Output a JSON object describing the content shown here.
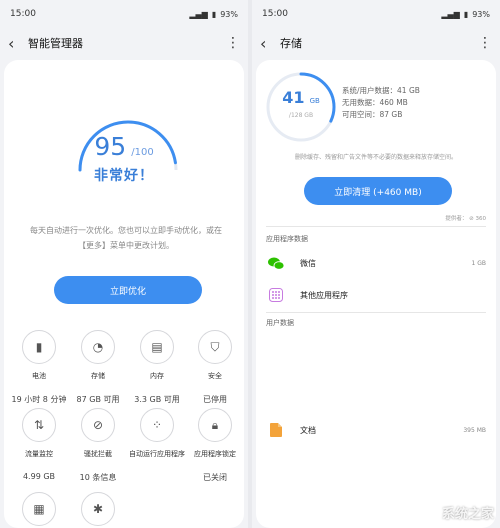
{
  "left": {
    "status": {
      "time": "15:00",
      "battery": "93%"
    },
    "title": "智能管理器",
    "score": "95",
    "score_max": "/100",
    "verdict": "非常好！",
    "score_fraction": 0.95,
    "description": "每天自动进行一次优化。您也可以立即手动优化，或在【更多】菜单中更改计划。",
    "optimize_button": "立即优化",
    "tiles": [
      {
        "icon": "battery-icon",
        "label": "电池",
        "value": "19 小时 8 分钟"
      },
      {
        "icon": "storage-icon",
        "label": "存储",
        "value": "87 GB 可用"
      },
      {
        "icon": "memory-icon",
        "label": "内存",
        "value": "3.3 GB 可用"
      },
      {
        "icon": "shield-icon",
        "label": "安全",
        "value": "已停用"
      },
      {
        "icon": "data-monitor-icon",
        "label": "流量监控",
        "value": "4.99 GB"
      },
      {
        "icon": "block-icon",
        "label": "骚扰拦截",
        "value": "10 条信息"
      },
      {
        "icon": "autostart-icon",
        "label": "自动运行应用程序",
        "value": ""
      },
      {
        "icon": "lock-icon",
        "label": "应用程序锁定",
        "value": "已关闭"
      }
    ]
  },
  "right": {
    "status": {
      "time": "15:00",
      "battery": "93%"
    },
    "title": "存储",
    "used": "41",
    "used_unit": "GB",
    "total": "/128 GB",
    "used_fraction": 0.32,
    "stats": [
      "系统/用户数据：41 GB",
      "无用数据：460 MB",
      "可用空间：87 GB"
    ],
    "hint": "删除缓存、残留和广告文件等不必要的数据来释放存储空间。",
    "clean_button": "立即清理 (+460 MB)",
    "powered_by": "提供者：  ⊘ 360",
    "app_data_label": "应用程序数据",
    "apps": [
      {
        "icon": "wechat-icon",
        "name": "微信",
        "size": "1 GB"
      },
      {
        "icon": "other-apps-icon",
        "name": "其他应用程序",
        "size": ""
      }
    ],
    "user_data_label": "用户数据",
    "documents": {
      "icon": "document-icon",
      "name": "文档",
      "size": "395 MB"
    }
  },
  "watermark": "系统之家",
  "colors": {
    "accent": "#3d8ef0",
    "wechat": "#2dc100",
    "document": "#f3a33a"
  }
}
